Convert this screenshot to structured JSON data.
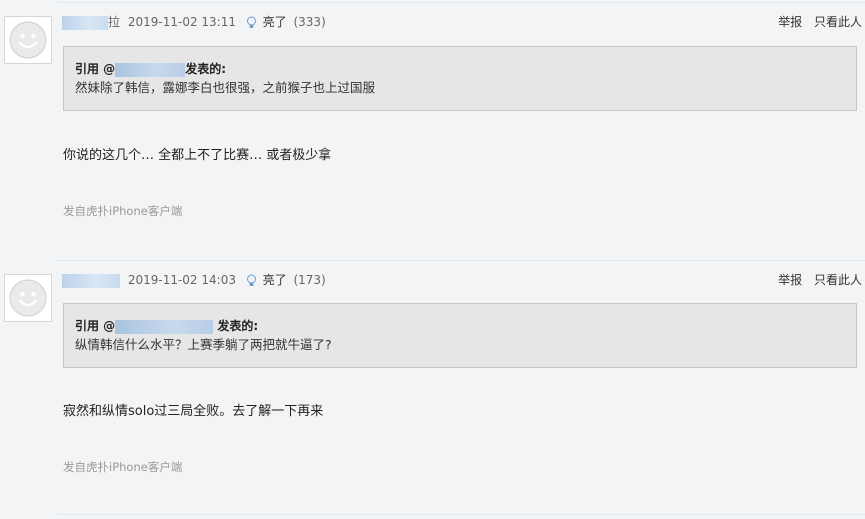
{
  "posts": [
    {
      "user_suffix": "拉",
      "time": "2019-11-02 13:11",
      "light_label": "亮了",
      "light_count": "(333)",
      "report_label": "举报",
      "only_author_label": "只看此人",
      "quote": {
        "prefix": "引用 @",
        "suffix": "发表的:",
        "text": "然妹除了韩信，露娜李白也很强，之前猴子也上过国服"
      },
      "content": "你说的这几个… 全都上不了比赛… 或者极少拿",
      "source": "发自虎扑iPhone客户端"
    },
    {
      "user_suffix": "",
      "time": "2019-11-02 14:03",
      "light_label": "亮了",
      "light_count": "(173)",
      "report_label": "举报",
      "only_author_label": "只看此人",
      "quote": {
        "prefix": "引用 @",
        "suffix": "发表的:",
        "text": "纵情韩信什么水平？上赛季躺了两把就牛逼了?"
      },
      "content": "寂然和纵情solo过三局全败。去了解一下再来",
      "source": "发自虎扑iPhone客户端"
    }
  ]
}
